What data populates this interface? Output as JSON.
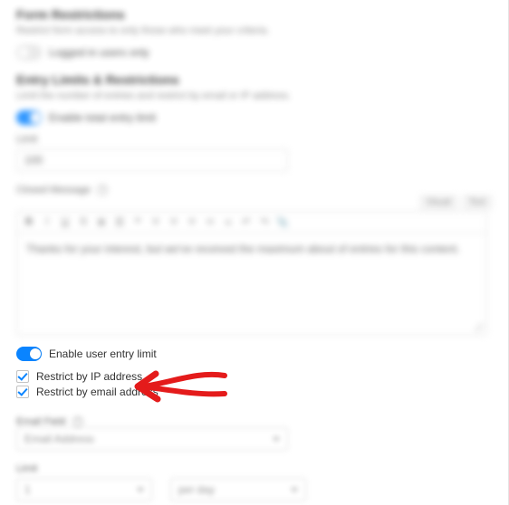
{
  "sections": {
    "formRestrictions": {
      "title": "Form Restrictions",
      "description": "Restrict form access to only those who meet your criteria.",
      "loggedIn": {
        "label": "Logged in users only",
        "on": false
      }
    },
    "entryLimits": {
      "title": "Entry Limits & Restrictions",
      "description": "Limit the number of entries and restrict by email or IP address.",
      "enableTotal": {
        "label": "Enable total entry limit",
        "on": true
      },
      "limit": {
        "label": "Limit",
        "value": "100"
      },
      "closedMessage": {
        "label": "Closed Message",
        "tabs": {
          "visual": "Visual",
          "text": "Text"
        },
        "body": "Thanks for your interest, but we've received the maximum about of entries for this content."
      },
      "enableUser": {
        "label": "Enable user entry limit",
        "on": true
      },
      "restrictIP": {
        "label": "Restrict by IP address",
        "checked": true
      },
      "restrictEmail": {
        "label": "Restrict by email address",
        "checked": true
      },
      "emailField": {
        "label": "Email Field",
        "selected": "Email Address"
      },
      "userLimit": {
        "label": "Limit",
        "value": "1",
        "per": "per day"
      }
    }
  }
}
